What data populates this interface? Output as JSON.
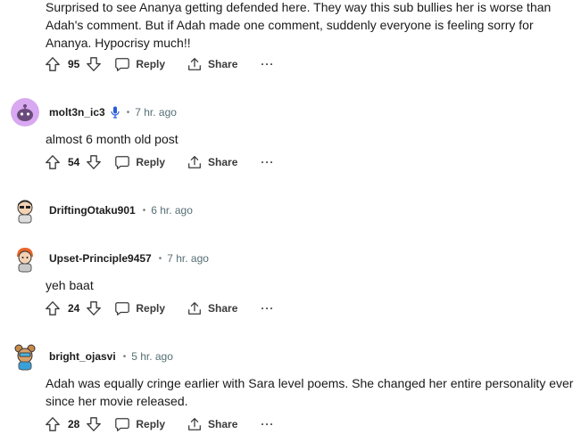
{
  "comments": [
    {
      "text": "Surprised to see Ananya getting defended here. They way this sub bullies her is worse than Adah's comment. But if Adah made one comment, suddenly everyone is feeling sorry for Ananya. Hypocrisy much!!",
      "votes": "95"
    },
    {
      "username": "molt3n_ic3",
      "time": "7 hr. ago",
      "text": "almost 6 month old post",
      "votes": "54"
    },
    {
      "username": "DriftingOtaku901",
      "time": "6 hr. ago"
    },
    {
      "username": "Upset-Principle9457",
      "time": "7 hr. ago",
      "text": "yeh baat",
      "votes": "24"
    },
    {
      "username": "bright_ojasvi",
      "time": "5 hr. ago",
      "text": "Adah was equally cringe earlier with Sara level poems. She changed her entire personality ever since her movie released.",
      "votes": "28"
    }
  ],
  "labels": {
    "reply": "Reply",
    "share": "Share",
    "more": "···",
    "dot": "•"
  },
  "icons": {
    "upvote": "upvote-arrow-icon",
    "downvote": "downvote-arrow-icon",
    "reply": "speech-bubble-icon",
    "share": "share-upload-icon",
    "mic": "microphone-icon"
  },
  "colors": {
    "avatar_molt3n": "#d8a8f0",
    "mic": "#2a5bd7",
    "time": "#576f76"
  }
}
